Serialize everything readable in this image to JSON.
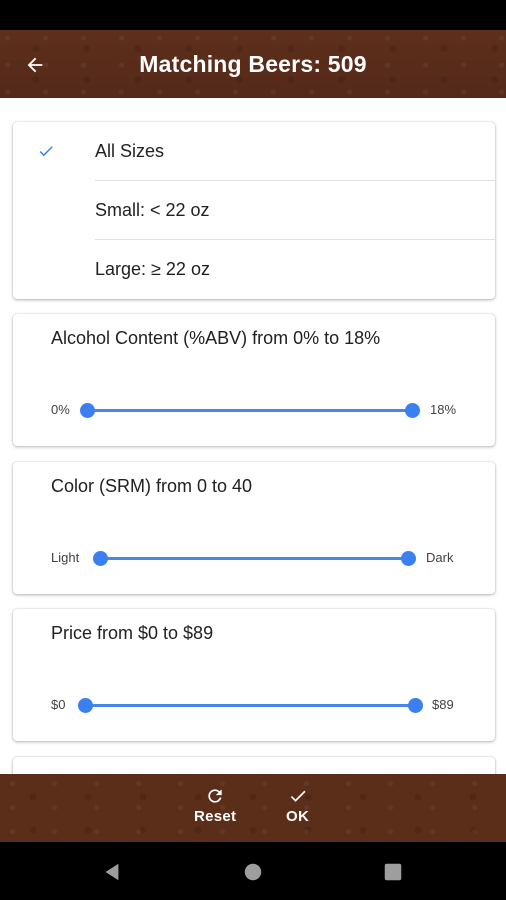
{
  "app_bar": {
    "title": "Matching Beers: 509",
    "back_icon": "arrow-back-icon"
  },
  "size_filter": {
    "items": [
      {
        "label": "All Sizes",
        "selected": true
      },
      {
        "label": "Small: < 22 oz",
        "selected": false
      },
      {
        "label": "Large: ≥ 22 oz",
        "selected": false
      }
    ],
    "check_icon": "check-icon"
  },
  "sliders": [
    {
      "title": "Alcohol Content (%ABV) from 0% to 18%",
      "min_label": "0%",
      "max_label": "18%",
      "range": [
        0,
        18
      ],
      "selected": [
        0,
        18
      ]
    },
    {
      "title": "Color (SRM) from 0 to 40",
      "min_label": "Light",
      "max_label": "Dark",
      "range": [
        0,
        40
      ],
      "selected": [
        0,
        40
      ]
    },
    {
      "title": "Price from $0 to $89",
      "min_label": "$0",
      "max_label": "$89",
      "range": [
        0,
        89
      ],
      "selected": [
        0,
        89
      ]
    }
  ],
  "bottom_bar": {
    "reset_label": "Reset",
    "reset_icon": "refresh-icon",
    "ok_label": "OK",
    "ok_icon": "check-icon"
  },
  "nav": {
    "back_icon": "nav-back-icon",
    "home_icon": "nav-home-icon",
    "recents_icon": "nav-recents-icon"
  },
  "colors": {
    "app_bar": "#5b2e1a",
    "accent": "#3b7ff0",
    "text": "#212121"
  }
}
